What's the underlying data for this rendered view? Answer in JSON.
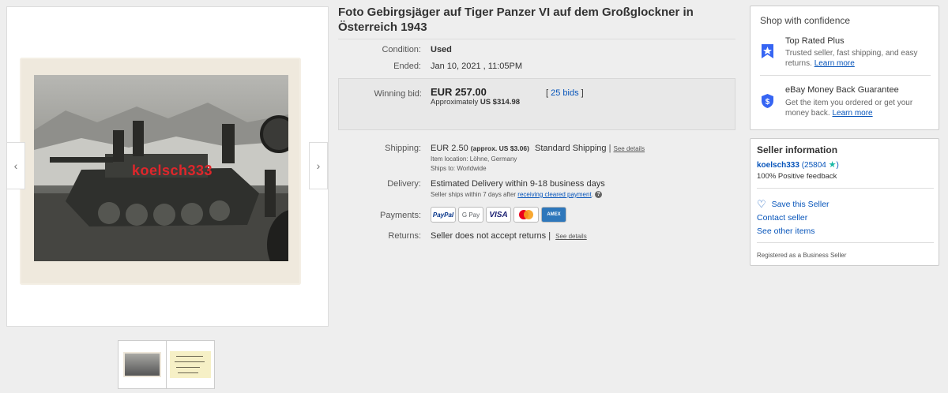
{
  "gallery": {
    "watermark": "koelsch333",
    "prev_arrow": "‹",
    "next_arrow": "›",
    "thumbnails": [
      "thumb-photo-front",
      "thumb-photo-back"
    ]
  },
  "listing": {
    "title": "Foto Gebirgsjäger auf Tiger Panzer VI auf dem Großglockner in Österreich 1943",
    "condition_label": "Condition:",
    "condition_value": "Used",
    "ended_label": "Ended:",
    "ended_value": "Jan 10, 2021 , 11:05PM",
    "bid": {
      "label": "Winning bid:",
      "price": "EUR 257.00",
      "approx_prefix": "Approximately",
      "approx_value": "US $314.98",
      "bids_open": "[",
      "bids_link": "25 bids",
      "bids_close": "]"
    },
    "shipping": {
      "label": "Shipping:",
      "cost": "EUR 2.50",
      "approx": "(approx. US $3.06)",
      "method": "Standard Shipping",
      "details_link": "See details",
      "location": "Item location:  Löhne, Germany",
      "ships_to": "Ships to:  Worldwide"
    },
    "delivery": {
      "label": "Delivery:",
      "estimate": "Estimated Delivery within 9-18 business days",
      "note": "Seller ships within 7 days after",
      "note_link": "receiving cleared payment",
      "note_end": "."
    },
    "payments": {
      "label": "Payments:",
      "methods": [
        "PayPal",
        "G Pay",
        "VISA",
        "Mastercard",
        "AMEX"
      ]
    },
    "returns": {
      "label": "Returns:",
      "value": "Seller does not accept returns |",
      "details_link": "See details"
    }
  },
  "confidence": {
    "title": "Shop with confidence",
    "items": [
      {
        "title": "Top Rated Plus",
        "desc": "Trusted seller, fast shipping, and easy returns.",
        "link": "Learn more",
        "icon": "top-rated-icon",
        "color": "#3665f3"
      },
      {
        "title": "eBay Money Back Guarantee",
        "desc": "Get the item you ordered or get your money back.",
        "link": "Learn more",
        "icon": "shield-dollar-icon",
        "color": "#3665f3"
      }
    ]
  },
  "seller": {
    "title": "Seller information",
    "name": "koelsch333",
    "score": "(25804",
    "score_end": ")",
    "feedback": "100% Positive feedback",
    "save_label": "Save this Seller",
    "contact_label": "Contact seller",
    "other_items_label": "See other items",
    "registered": "Registered as a Business Seller"
  }
}
